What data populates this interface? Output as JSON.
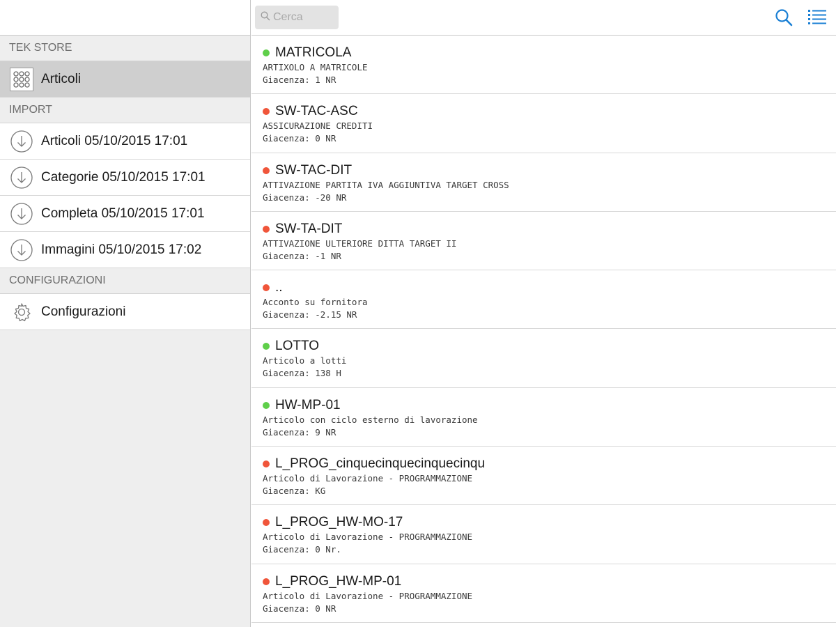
{
  "sidebar": {
    "sections": [
      {
        "title": "TEK STORE"
      },
      {
        "title": "IMPORT"
      },
      {
        "title": "CONFIGURAZIONI"
      }
    ],
    "store_items": [
      {
        "label": "Articoli",
        "icon": "grid-icon",
        "selected": true
      }
    ],
    "import_items": [
      {
        "label": "Articoli 05/10/2015 17:01",
        "icon": "download-circle-icon"
      },
      {
        "label": "Categorie 05/10/2015 17:01",
        "icon": "download-circle-icon"
      },
      {
        "label": "Completa 05/10/2015 17:01",
        "icon": "download-circle-icon"
      },
      {
        "label": "Immagini 05/10/2015 17:02",
        "icon": "download-circle-icon"
      }
    ],
    "config_items": [
      {
        "label": "Configurazioni",
        "icon": "gear-icon"
      }
    ]
  },
  "search": {
    "placeholder": "Cerca",
    "value": ""
  },
  "toolbar": {
    "icons": [
      "search-icon",
      "list-icon"
    ],
    "accent_color": "#1a7fd4"
  },
  "status_colors": {
    "available": "#5fcf4a",
    "unavailable": "#f0553a"
  },
  "articles": [
    {
      "code": "MATRICOLA",
      "description": "ARTIXOLO A MATRICOLE",
      "stock": "Giacenza: 1 NR",
      "status": "green"
    },
    {
      "code": "SW-TAC-ASC",
      "description": "ASSICURAZIONE CREDITI",
      "stock": "Giacenza: 0 NR",
      "status": "red"
    },
    {
      "code": "SW-TAC-DIT",
      "description": "ATTIVAZIONE PARTITA IVA AGGIUNTIVA TARGET CROSS",
      "stock": "Giacenza: -20 NR",
      "status": "red"
    },
    {
      "code": "SW-TA-DIT",
      "description": "ATTIVAZIONE ULTERIORE DITTA TARGET II",
      "stock": "Giacenza: -1 NR",
      "status": "red"
    },
    {
      "code": "..",
      "description": "Acconto su fornitora",
      "stock": "Giacenza: -2.15 NR",
      "status": "red"
    },
    {
      "code": "LOTTO",
      "description": "Articolo a lotti",
      "stock": "Giacenza: 138 H",
      "status": "green"
    },
    {
      "code": "HW-MP-01",
      "description": "Articolo con ciclo esterno di lavorazione",
      "stock": "Giacenza: 9 NR",
      "status": "green"
    },
    {
      "code": "L_PROG_cinquecinquecinquecinqu",
      "description": "Articolo di Lavorazione - PROGRAMMAZIONE",
      "stock": "Giacenza: KG",
      "status": "red"
    },
    {
      "code": "L_PROG_HW-MO-17",
      "description": "Articolo di Lavorazione - PROGRAMMAZIONE",
      "stock": "Giacenza: 0 Nr.",
      "status": "red"
    },
    {
      "code": "L_PROG_HW-MP-01",
      "description": "Articolo di Lavorazione - PROGRAMMAZIONE",
      "stock": "Giacenza: 0 NR",
      "status": "red"
    }
  ]
}
